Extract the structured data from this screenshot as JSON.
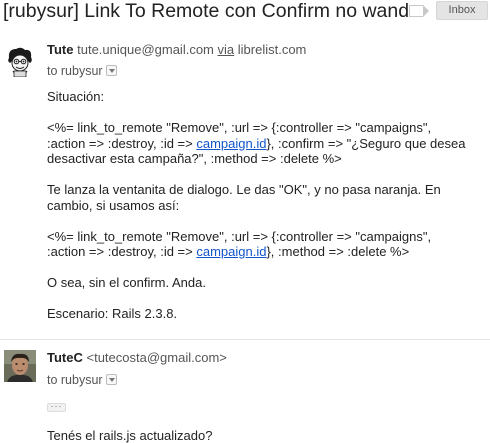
{
  "subject": "[rubysur] Link To Remote con Confirm no wanda",
  "inbox_label": "Inbox",
  "messages": [
    {
      "sender_name": "Tute",
      "sender_email": "tute.unique@gmail.com",
      "via_word": "via",
      "via_domain": "librelist.com",
      "to": "to rubysur",
      "avatar_icon": "cartoon-avatar-icon",
      "lines": {
        "situacion": "Situación:",
        "code1_a": "<%= link_to_remote \"Remove\", :url => {:controller => \"campaigns\",",
        "code1_b_pre": ":action => :destroy, :id => ",
        "code1_b_link": "campaign.id",
        "code1_b_post": "}, :confirm => \"¿Seguro que desea",
        "code1_c": "desactivar esta campaña?\", :method => :delete %>",
        "para2_a": "Te lanza la ventanita de dialogo. Le das \"OK\", y no pasa naranja. En",
        "para2_b": "cambio, si usamos así:",
        "code2_a": "<%= link_to_remote \"Remove\", :url => {:controller => \"campaigns\",",
        "code2_b_pre": ":action => :destroy, :id => ",
        "code2_b_link": "campaign.id",
        "code2_b_post": "}, :method => :delete %>",
        "para3": "O sea, sin el confirm. Anda.",
        "para4": "Escenario: Rails 2.3.8."
      }
    },
    {
      "sender_name": "TuteC",
      "sender_email": "<tutecosta@gmail.com>",
      "to": "to rubysur",
      "avatar_icon": "photo-avatar-icon",
      "ellipsis": "···",
      "body": "Tenés el rails.js actualizado?"
    }
  ]
}
